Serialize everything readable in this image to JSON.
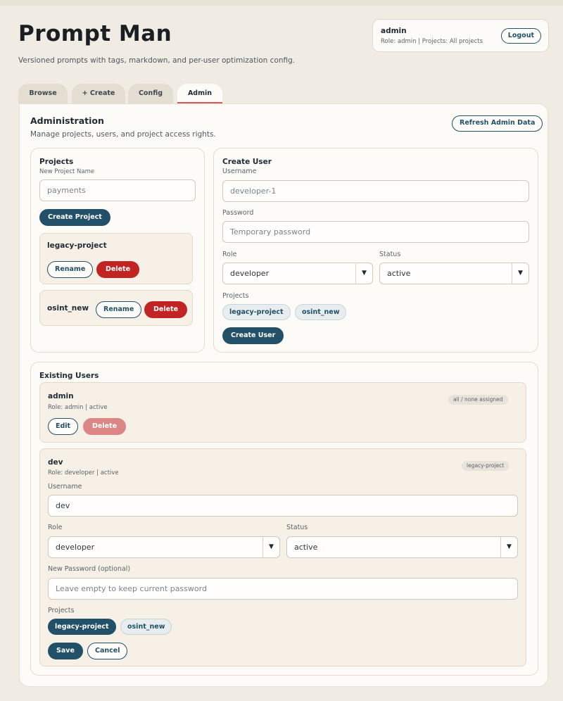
{
  "app": {
    "title": "Prompt Man",
    "subtitle": "Versioned prompts with tags, markdown, and per-user optimization config."
  },
  "session": {
    "username": "admin",
    "meta": "Role: admin | Projects: All projects",
    "logout_label": "Logout"
  },
  "tabs": [
    {
      "label": "Browse",
      "active": false
    },
    {
      "label": "+ Create",
      "active": false
    },
    {
      "label": "Config",
      "active": false
    },
    {
      "label": "Admin",
      "active": true
    }
  ],
  "admin": {
    "title": "Administration",
    "description": "Manage projects, users, and project access rights.",
    "refresh_label": "Refresh Admin Data"
  },
  "projects": {
    "title": "Projects",
    "new_name_label": "New Project Name",
    "new_name_placeholder": "payments",
    "create_label": "Create Project",
    "items": [
      {
        "name": "legacy-project",
        "rename_label": "Rename",
        "delete_label": "Delete"
      },
      {
        "name": "osint_new",
        "rename_label": "Rename",
        "delete_label": "Delete"
      }
    ]
  },
  "create_user": {
    "title": "Create User",
    "username_label": "Username",
    "username_placeholder": "developer-1",
    "password_label": "Password",
    "password_placeholder": "Temporary password",
    "role_label": "Role",
    "role_value": "developer",
    "status_label": "Status",
    "status_value": "active",
    "projects_label": "Projects",
    "project_chips": [
      "legacy-project",
      "osint_new"
    ],
    "submit_label": "Create User"
  },
  "existing_users": {
    "title": "Existing Users",
    "admin_user": {
      "name": "admin",
      "meta": "Role: admin | active",
      "tag": "all / none assigned",
      "edit_label": "Edit",
      "delete_label": "Delete"
    },
    "dev_user": {
      "name": "dev",
      "meta": "Role: developer | active",
      "tag": "legacy-project",
      "username_label": "Username",
      "username_value": "dev",
      "role_label": "Role",
      "role_value": "developer",
      "status_label": "Status",
      "status_value": "active",
      "password_label": "New Password (optional)",
      "password_placeholder": "Leave empty to keep current password",
      "projects_label": "Projects",
      "project_chips": [
        {
          "label": "legacy-project",
          "selected": true
        },
        {
          "label": "osint_new",
          "selected": false
        }
      ],
      "save_label": "Save",
      "cancel_label": "Cancel"
    }
  },
  "colors": {
    "primary": "#215068",
    "danger": "#c22424",
    "background": "#f1ece3",
    "active_tab_underline": "#d65b54"
  }
}
